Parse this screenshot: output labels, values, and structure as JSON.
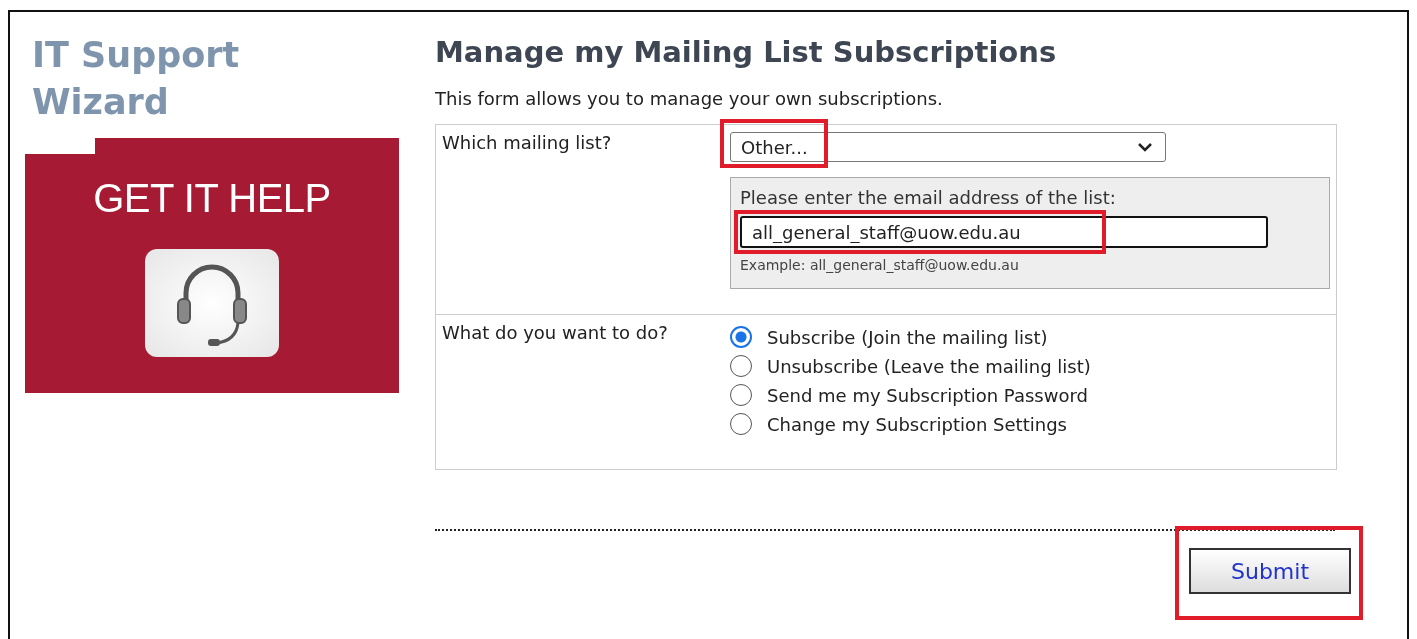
{
  "sidebar": {
    "title": "IT Support Wizard",
    "banner": {
      "label": "GET IT HELP"
    }
  },
  "page": {
    "heading": "Manage my Mailing List Subscriptions",
    "intro": "This form allows you to manage your own subscriptions."
  },
  "list_row": {
    "label": "Which mailing list?",
    "select": {
      "value": "Other...",
      "highlighted": true
    },
    "other_panel": {
      "prompt": "Please enter the email address of the list:",
      "input": {
        "value": "all_general_staff@uow.edu.au",
        "highlighted": true
      },
      "example": "Example: all_general_staff@uow.edu.au"
    }
  },
  "action_row": {
    "label": "What do you want to do?",
    "options": [
      {
        "label": "Subscribe (Join the mailing list)",
        "selected": true
      },
      {
        "label": "Unsubscribe (Leave the mailing list)",
        "selected": false
      },
      {
        "label": "Send me my Subscription Password",
        "selected": false
      },
      {
        "label": "Change my Subscription Settings",
        "selected": false
      }
    ]
  },
  "submit": {
    "label": "Submit",
    "highlighted": true
  }
}
